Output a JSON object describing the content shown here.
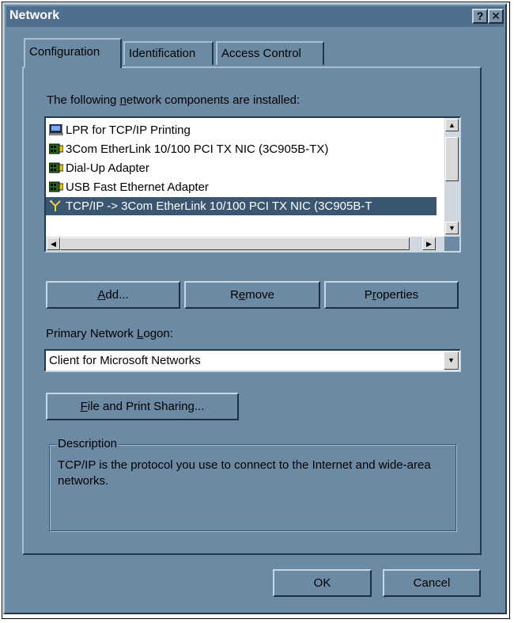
{
  "window": {
    "title": "Network",
    "help_label": "?",
    "close_label": "✕"
  },
  "tabs": [
    {
      "label": "Configuration",
      "active": true
    },
    {
      "label": "Identification",
      "active": false
    },
    {
      "label": "Access Control",
      "active": false
    }
  ],
  "components": {
    "label_pre": "The following ",
    "label_key": "n",
    "label_post": "etwork components are installed:",
    "items": [
      {
        "label": "LPR for TCP/IP Printing",
        "icon": "computer-icon",
        "selected": false
      },
      {
        "label": "3Com EtherLink 10/100 PCI TX NIC (3C905B-TX)",
        "icon": "network-adapter-icon",
        "selected": false
      },
      {
        "label": "Dial-Up Adapter",
        "icon": "network-adapter-icon",
        "selected": false
      },
      {
        "label": "USB Fast Ethernet Adapter",
        "icon": "network-adapter-icon",
        "selected": false
      },
      {
        "label": "TCP/IP -> 3Com EtherLink 10/100 PCI TX NIC (3C905B-T",
        "icon": "protocol-icon",
        "selected": true
      }
    ]
  },
  "buttons": {
    "add_key": "A",
    "add_rest": "dd...",
    "remove_pre": "R",
    "remove_key": "e",
    "remove_rest": "move",
    "properties_pre": "P",
    "properties_key": "r",
    "properties_rest": "operties",
    "file_sharing_key": "F",
    "file_sharing_rest": "ile and Print Sharing...",
    "ok_label": "OK",
    "cancel_label": "Cancel"
  },
  "logon": {
    "label_pre": "Primary Network ",
    "label_key": "L",
    "label_post": "ogon:",
    "value": "Client for Microsoft Networks"
  },
  "description": {
    "title": "Description",
    "text": "TCP/IP is the protocol you use to connect to the Internet and wide-area networks."
  },
  "colors": {
    "dialog_face": "#6d8aa5",
    "selection": "#3a5670",
    "title_bar": "#4f6f8f"
  }
}
